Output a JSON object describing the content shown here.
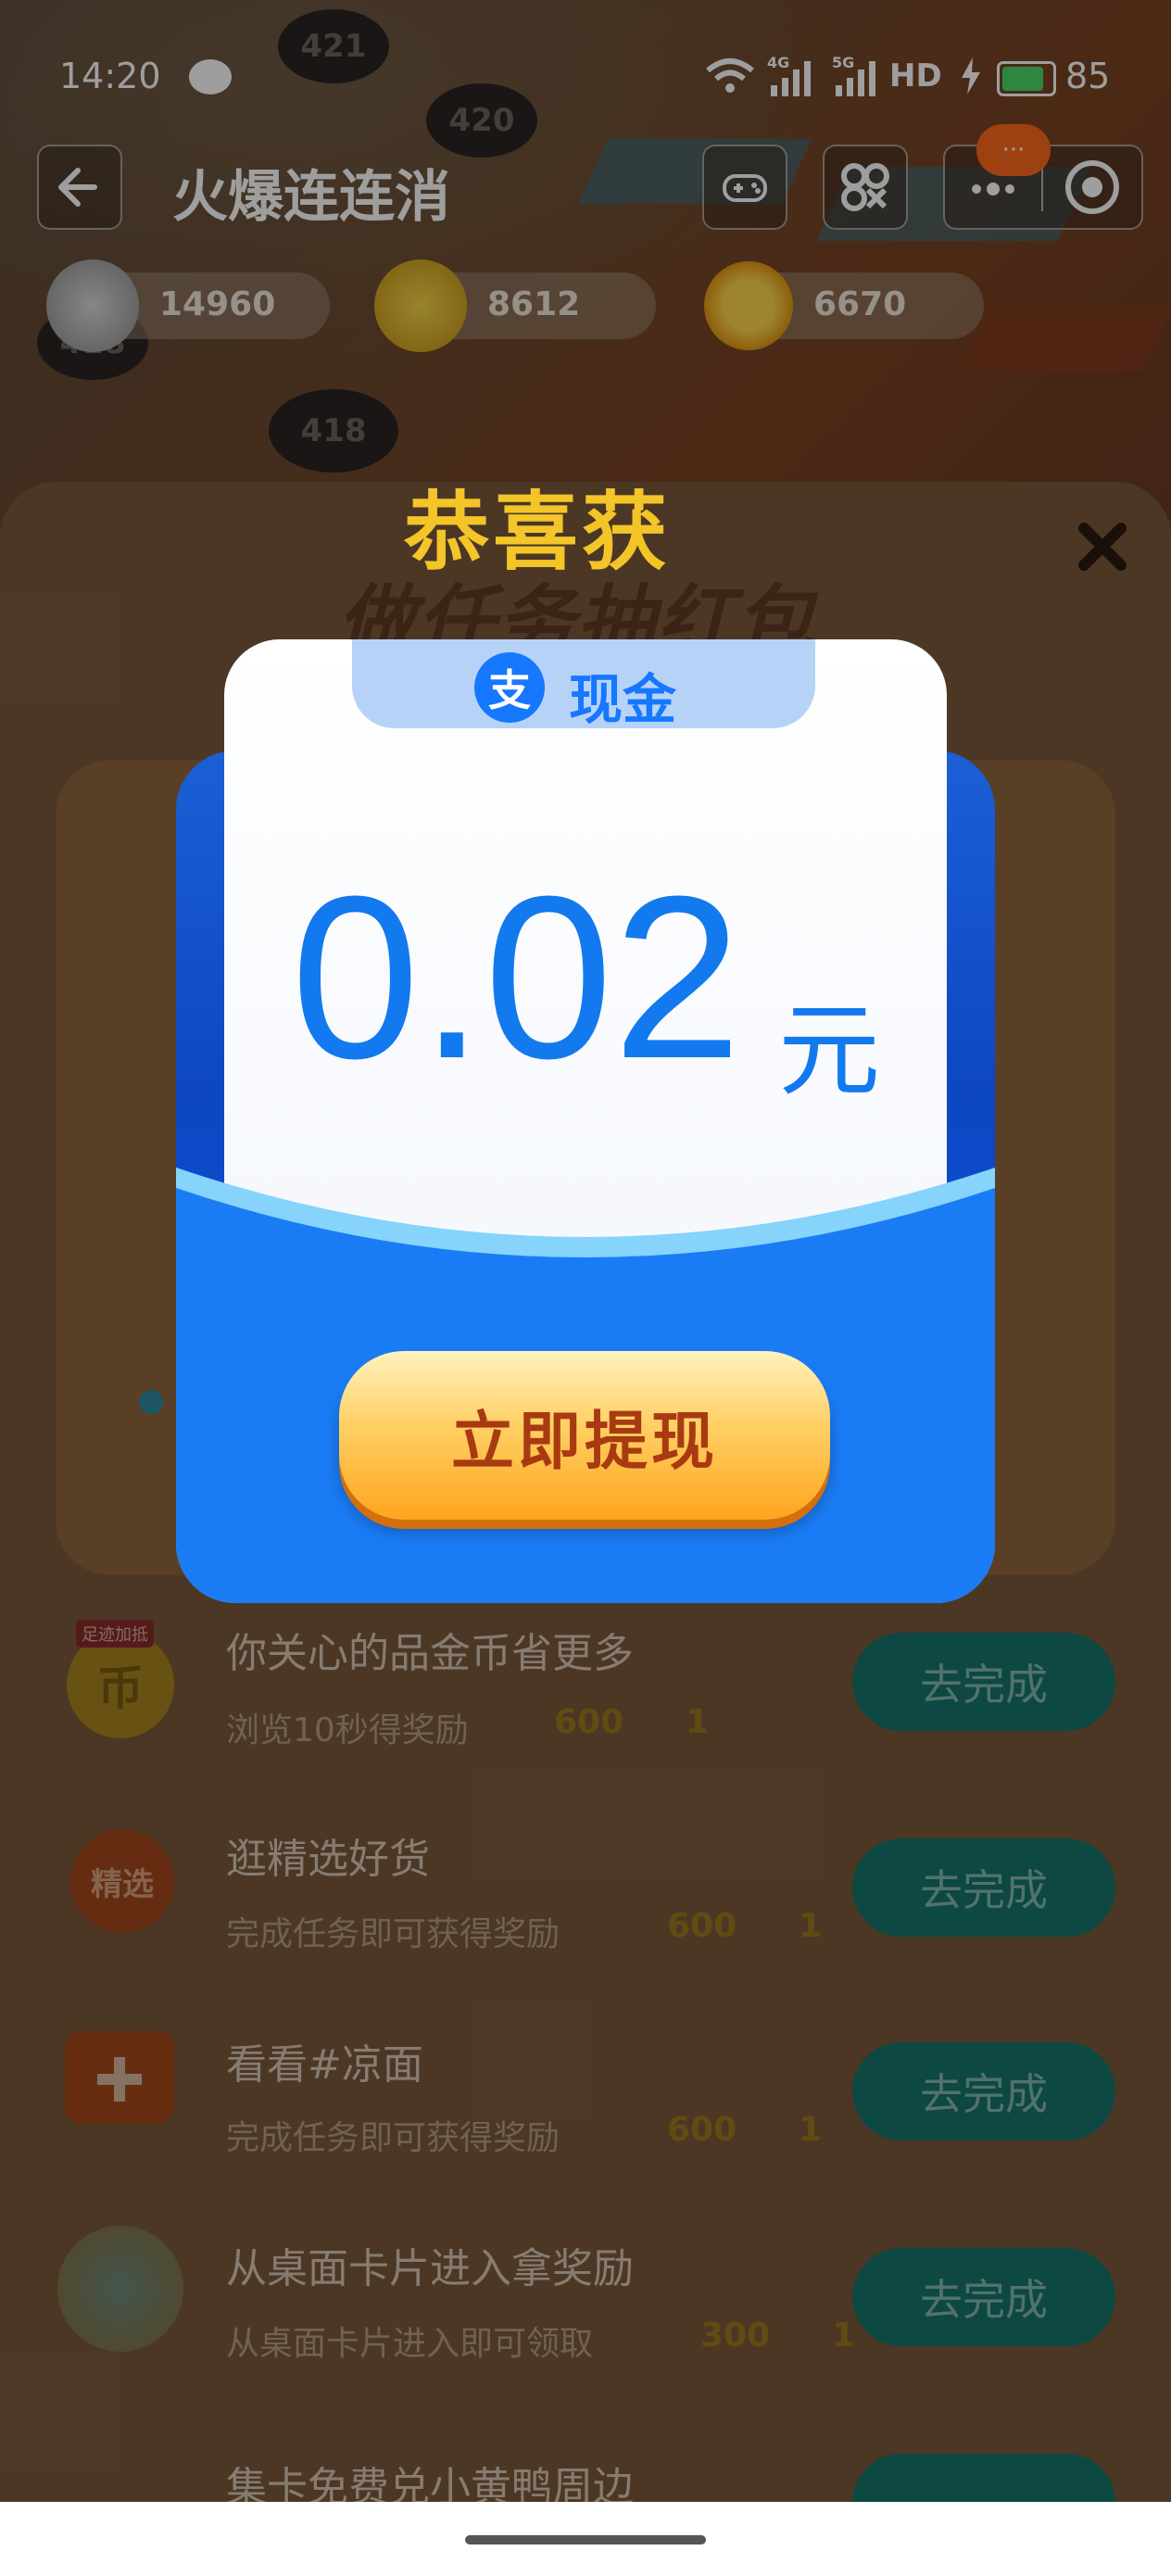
{
  "status_bar": {
    "time": "14:20",
    "network_4g": "4G",
    "network_5g": "5G",
    "hd": "HD",
    "battery": "85",
    "icons": [
      "wechat-icon",
      "wifi-icon",
      "signal-icon",
      "charging-icon",
      "battery-icon"
    ]
  },
  "nav": {
    "title": "火爆连连消",
    "more_badge": "···"
  },
  "currencies": [
    {
      "icon": "silver-coin-icon",
      "value": "14960"
    },
    {
      "icon": "gold-coin-icon",
      "value": "8612"
    },
    {
      "icon": "sun-icon",
      "value": "6670"
    }
  ],
  "game_tiles": [
    "421",
    "420",
    "418",
    "418"
  ],
  "card": {
    "header_line1": "恭喜获",
    "header_line2": "做任务抽红包"
  },
  "popup": {
    "tab_label": "现金",
    "amount": "0.02",
    "unit": "元",
    "withdraw_label": "立即提现"
  },
  "tasks": [
    {
      "badge": "足迹加抵",
      "icon_text": "币",
      "title": "你关心的品金币省更多",
      "desc": "浏览10秒得奖励",
      "coins": "600",
      "keys": "1",
      "button": "去完成"
    },
    {
      "icon_text": "精选",
      "title": "逛精选好货",
      "desc": "完成任务即可获得奖励",
      "coins": "600",
      "keys": "1",
      "button": "去完成"
    },
    {
      "icon_text": "",
      "title": "看看#凉面",
      "desc": "完成任务即可获得奖励",
      "coins": "600",
      "keys": "1",
      "button": "去完成"
    },
    {
      "icon_text": "",
      "title": "从桌面卡片进入拿奖励",
      "desc": "从桌面卡片进入即可领取",
      "coins": "300",
      "keys": "1",
      "button": "去完成"
    },
    {
      "title": "集卡免费兑小黄鸭周边"
    }
  ]
}
